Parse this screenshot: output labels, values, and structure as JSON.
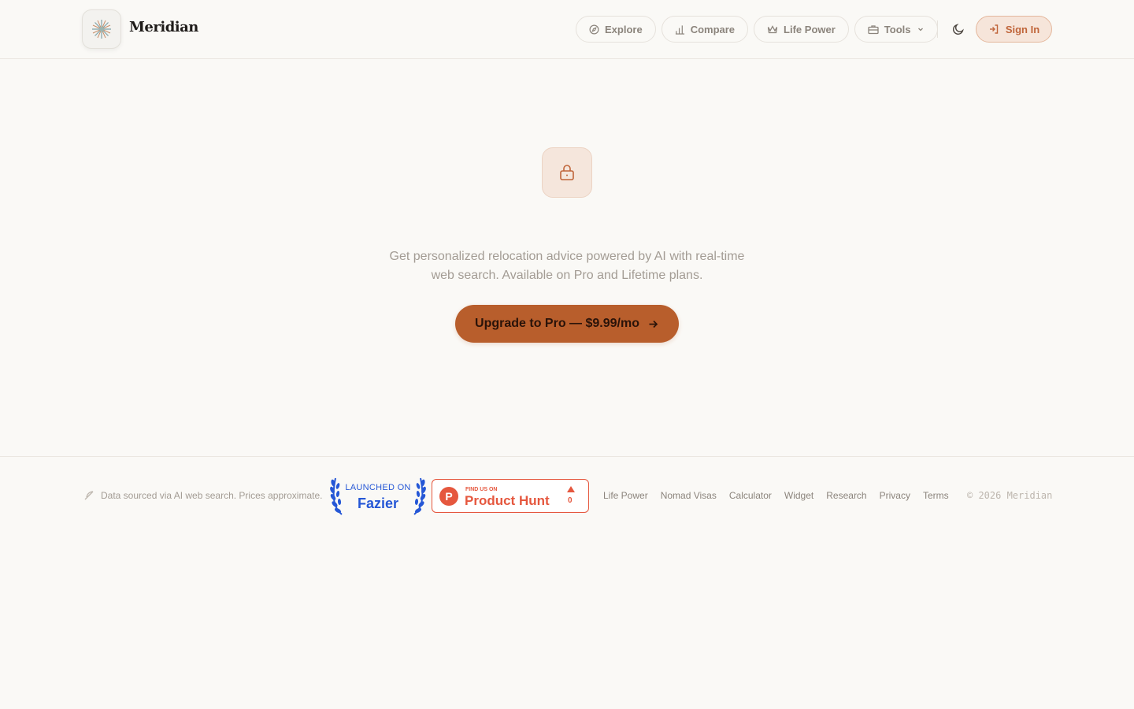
{
  "header": {
    "brand": "Meridian",
    "nav": [
      {
        "label": "Explore",
        "icon": "compass-icon"
      },
      {
        "label": "Compare",
        "icon": "bar-chart-icon"
      },
      {
        "label": "Life Power",
        "icon": "crown-icon"
      },
      {
        "label": "Tools",
        "icon": "toolbox-icon"
      }
    ],
    "signin_label": "Sign In"
  },
  "main": {
    "description": "Get personalized relocation advice powered by AI with real-time web search. Available on Pro and Lifetime plans.",
    "cta_label": "Upgrade to Pro — $9.99/mo"
  },
  "footer": {
    "note": "Data sourced via AI web search. Prices approximate.",
    "fazier": {
      "line1": "LAUNCHED ON",
      "line2": "Fazier"
    },
    "producthunt": {
      "small": "FIND US ON",
      "big": "Product Hunt",
      "count": "0",
      "letter": "P"
    },
    "links": [
      "Life Power",
      "Nomad Visas",
      "Calculator",
      "Widget",
      "Research",
      "Privacy",
      "Terms"
    ],
    "copyright": "© 2026 Meridian"
  },
  "colors": {
    "accent": "#b85e2c",
    "accent_light": "#f6e5da",
    "fazier_blue": "#2557d6",
    "producthunt_red": "#e5573e",
    "background": "#faf9f6"
  }
}
